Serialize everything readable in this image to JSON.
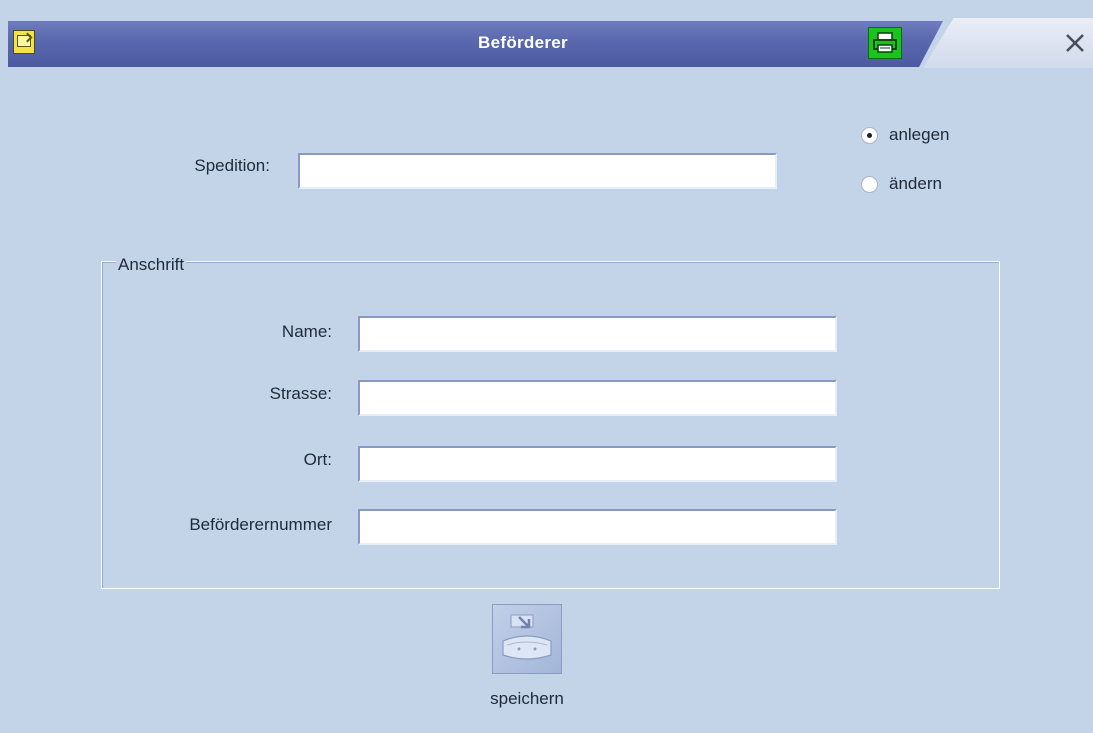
{
  "window": {
    "title": "Beförderer",
    "icons": {
      "app": "app-document-icon",
      "print": "printer-icon",
      "close": "close-icon"
    },
    "colors": {
      "title_bar": "#5967ad",
      "background": "#c3d3e8",
      "print_button": "#17c51c"
    }
  },
  "form": {
    "spedition": {
      "label": "Spedition:",
      "value": ""
    },
    "mode": {
      "options": [
        {
          "label": "anlegen",
          "selected": true
        },
        {
          "label": "ändern",
          "selected": false
        }
      ]
    },
    "address_group": {
      "title": "Anschrift",
      "fields": [
        {
          "label": "Name:",
          "value": ""
        },
        {
          "label": "Strasse:",
          "value": ""
        },
        {
          "label": "Ort:",
          "value": ""
        },
        {
          "label": "Beförderernummer",
          "value": ""
        }
      ]
    }
  },
  "save": {
    "label": "speichern",
    "icon": "save-icon"
  }
}
